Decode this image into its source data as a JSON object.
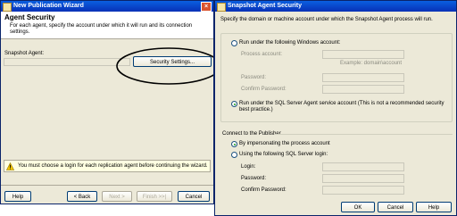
{
  "wizard": {
    "title": "New Publication Wizard",
    "heading": "Agent Security",
    "subtitle": "For each agent, specify the account under which it will run and its connection settings.",
    "snapshot_agent_label": "Snapshot Agent:",
    "security_settings_button": "Security Settings...",
    "warning_text": "You must choose a login for each replication agent before continuing the wizard.",
    "buttons": {
      "help": "Help",
      "back": "< Back",
      "next": "Next >",
      "finish": "Finish >>|",
      "cancel": "Cancel"
    }
  },
  "dialog": {
    "title": "Snapshot Agent Security",
    "intro": "Specify the domain or machine account under which the Snapshot Agent process will run.",
    "run_windows_label": "Run under the following Windows account:",
    "process_account_label": "Process account:",
    "process_account_value": "",
    "example_text": "Example: domain\\account",
    "password_label": "Password:",
    "confirm_password_label": "Confirm Password:",
    "run_sqlagent_label": "Run under the SQL Server Agent service account (This is not a recommended security best practice.)",
    "connect_heading": "Connect to the Publisher",
    "impersonate_label": "By impersonating the process account",
    "sql_login_option_label": "Using the following SQL Server login:",
    "login_label": "Login:",
    "password2_label": "Password:",
    "confirm_password2_label": "Confirm Password:",
    "selected_run_option": "sql_agent",
    "selected_connect_option": "impersonate",
    "buttons": {
      "ok": "OK",
      "cancel": "Cancel",
      "help": "Help"
    }
  },
  "colors": {
    "titlebar": "#0a5fe0",
    "dialog_face": "#ece9d8",
    "accent_border": "#003c74",
    "warning_icon": "#f2c500"
  }
}
